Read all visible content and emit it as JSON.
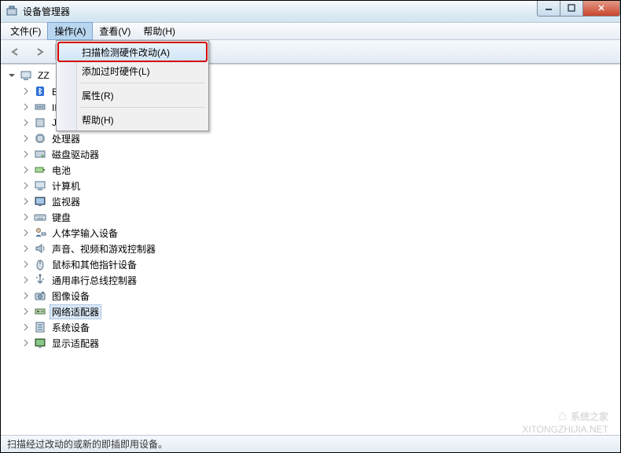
{
  "window": {
    "title": "设备管理器"
  },
  "menubar": {
    "file": "文件(F)",
    "action": "操作(A)",
    "view": "查看(V)",
    "help": "帮助(H)"
  },
  "dropdown": {
    "scan": "扫描检测硬件改动(A)",
    "addLegacy": "添加过时硬件(L)",
    "properties": "属性(R)",
    "help": "帮助(H)"
  },
  "tree": {
    "root": "ZZ",
    "items": [
      {
        "label": "Bluetooth 无线电收发器",
        "icon": "bluetooth"
      },
      {
        "label": "IDE ATA/ATAPI 控制器",
        "icon": "ide"
      },
      {
        "label": "Jungo",
        "icon": "jungo"
      },
      {
        "label": "处理器",
        "icon": "cpu"
      },
      {
        "label": "磁盘驱动器",
        "icon": "disk"
      },
      {
        "label": "电池",
        "icon": "battery"
      },
      {
        "label": "计算机",
        "icon": "computer"
      },
      {
        "label": "监视器",
        "icon": "monitor"
      },
      {
        "label": "键盘",
        "icon": "keyboard"
      },
      {
        "label": "人体学输入设备",
        "icon": "hid"
      },
      {
        "label": "声音、视频和游戏控制器",
        "icon": "sound"
      },
      {
        "label": "鼠标和其他指针设备",
        "icon": "mouse"
      },
      {
        "label": "通用串行总线控制器",
        "icon": "usb"
      },
      {
        "label": "图像设备",
        "icon": "camera"
      },
      {
        "label": "网络适配器",
        "icon": "network",
        "selected": true
      },
      {
        "label": "系统设备",
        "icon": "system"
      },
      {
        "label": "显示适配器",
        "icon": "display"
      }
    ]
  },
  "statusbar": {
    "text": "扫描经过改动的或新的即插即用设备。"
  },
  "watermark": {
    "brand": "系统之家",
    "url": "XITONGZHIJIA.NET"
  }
}
